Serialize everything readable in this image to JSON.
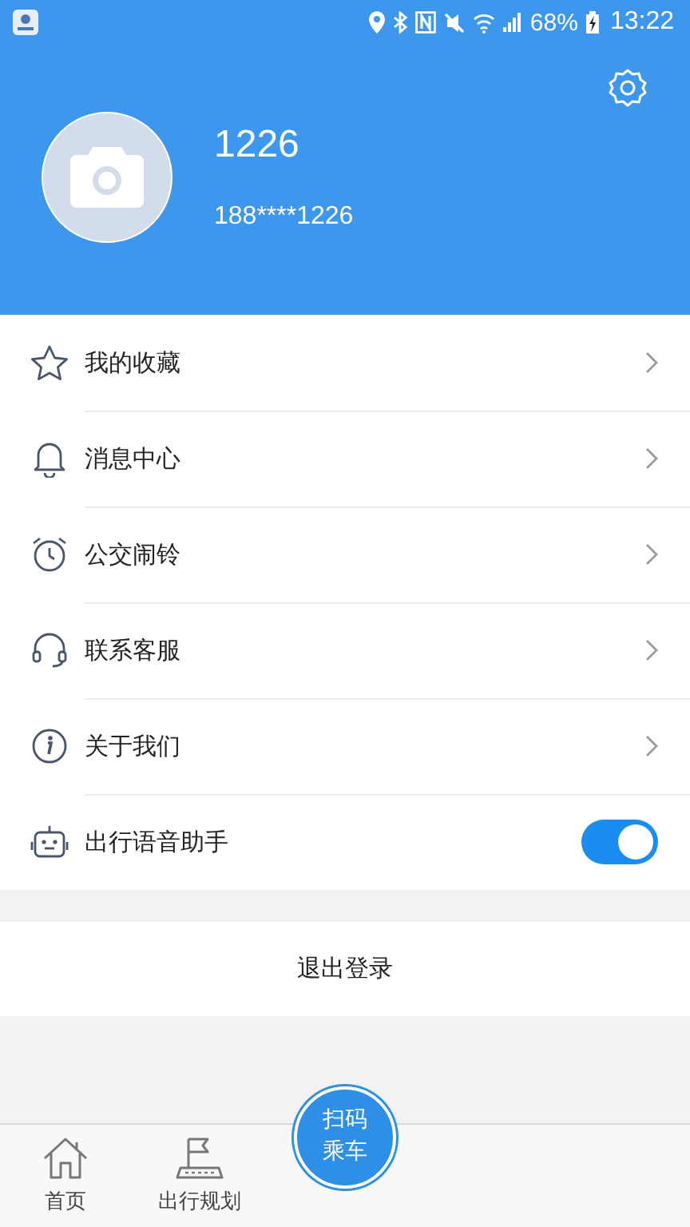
{
  "status_bar": {
    "battery": "68%",
    "time": "13:22"
  },
  "profile": {
    "name": "1226",
    "phone": "188****1226"
  },
  "menu": [
    {
      "kind": "link",
      "label": "我的收藏"
    },
    {
      "kind": "link",
      "label": "消息中心"
    },
    {
      "kind": "link",
      "label": "公交闹铃"
    },
    {
      "kind": "link",
      "label": "联系客服"
    },
    {
      "kind": "link",
      "label": "关于我们"
    },
    {
      "kind": "toggle",
      "label": "出行语音助手",
      "on": true
    }
  ],
  "logout": "退出登录",
  "scan_button": {
    "line_1": "扫码",
    "line_2": "乘车"
  },
  "bottom_nav": [
    {
      "label": "首页"
    },
    {
      "label": "出行规划"
    }
  ]
}
